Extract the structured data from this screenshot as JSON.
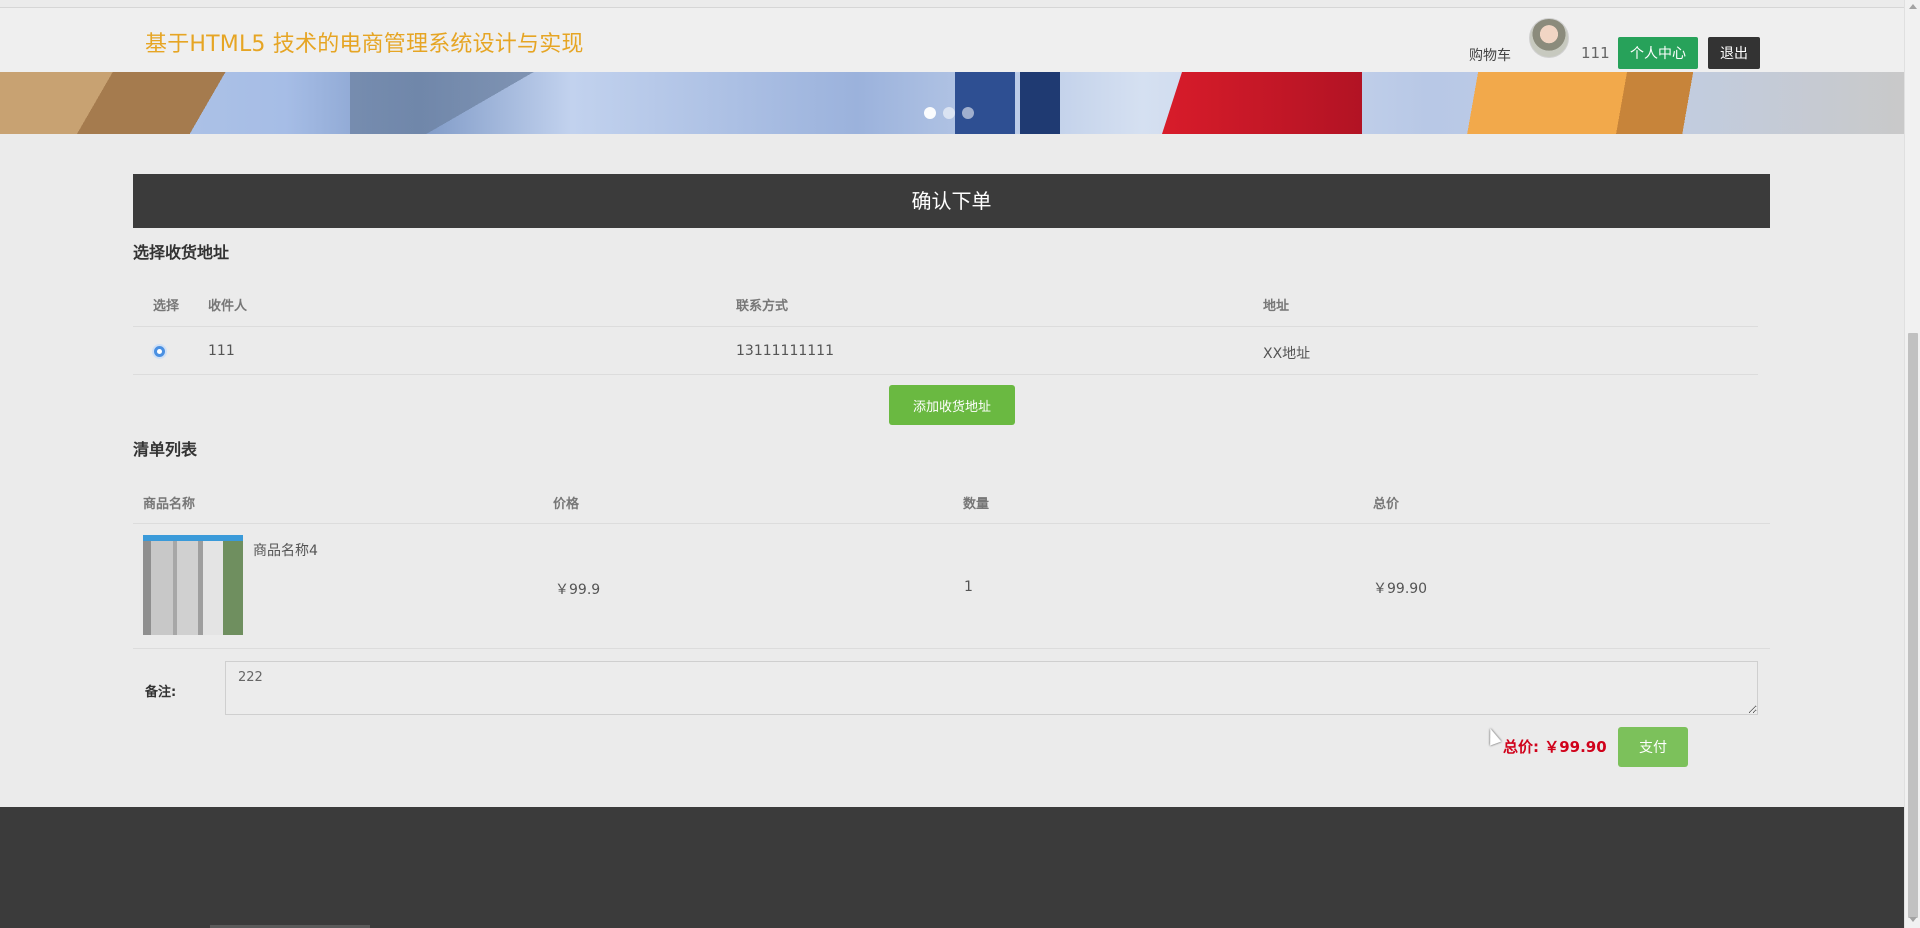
{
  "header": {
    "site_title": "基于HTML5 技术的电商管理系统设计与实现",
    "cart_label": "购物车",
    "username": "111",
    "personal_center_label": "个人中心",
    "logout_label": "退出"
  },
  "banner": {
    "active_slide": 1,
    "slide_count": 3
  },
  "page": {
    "confirm_title": "确认下单"
  },
  "address": {
    "section_title": "选择收货地址",
    "columns": [
      "选择",
      "收件人",
      "联系方式",
      "地址"
    ],
    "rows": [
      {
        "selected": true,
        "recipient": "111",
        "phone": "13111111111",
        "address": "XX地址"
      }
    ],
    "add_button_label": "添加收货地址"
  },
  "order_list": {
    "section_title": "清单列表",
    "columns": [
      "商品名称",
      "价格",
      "数量",
      "总价"
    ],
    "items": [
      {
        "name": "商品名称4",
        "price": "￥99.9",
        "quantity": "1",
        "total": "￥99.90"
      }
    ]
  },
  "remark": {
    "label": "备注:",
    "value": "222"
  },
  "summary": {
    "total_text": "总价: ￥99.90",
    "pay_button_label": "支付"
  },
  "colors": {
    "accent_title": "#e6a524",
    "green": "#27a25a",
    "dark": "#3b3b3b",
    "price_red": "#d0021b"
  }
}
